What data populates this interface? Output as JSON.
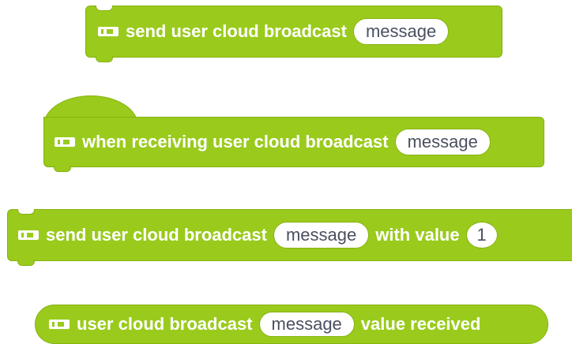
{
  "blocks": [
    {
      "prefix": "send user cloud broadcast",
      "input": "message"
    },
    {
      "prefix": "when receiving user cloud broadcast",
      "input": "message"
    },
    {
      "prefix": "send user cloud broadcast",
      "input": "message",
      "middle": "with value",
      "value": "1"
    },
    {
      "prefix": "user cloud broadcast",
      "input": "message",
      "suffix": "value received"
    }
  ],
  "icons": {
    "block_icon": "battery-icon"
  },
  "colors": {
    "block_fill": "#9acb1c",
    "block_border": "#86b20f",
    "input_text": "#4b5060"
  }
}
